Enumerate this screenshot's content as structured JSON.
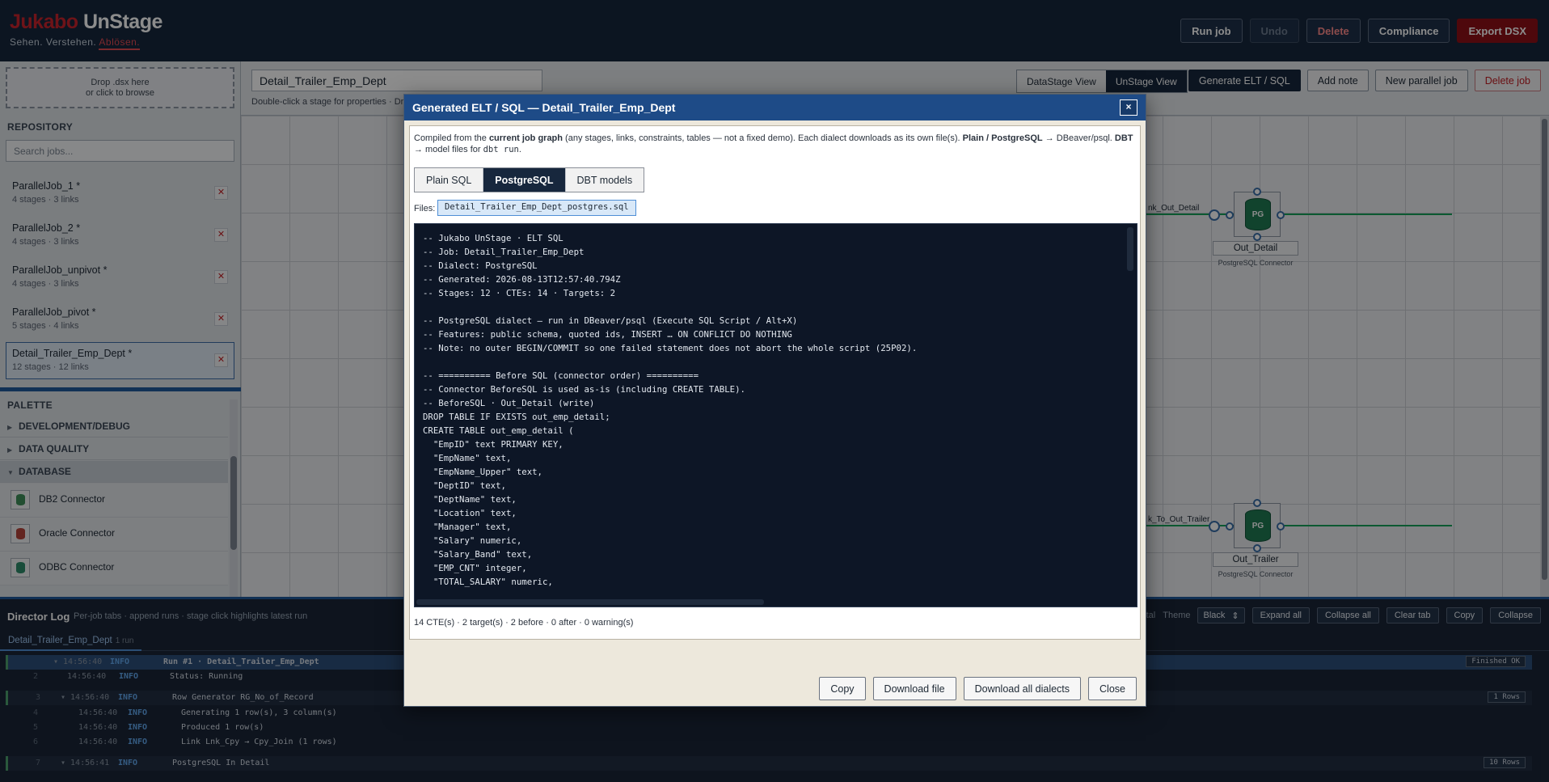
{
  "brand": {
    "name_part1": "Jukabo",
    "name_part2": " UnStage",
    "tagline": "Sehen. Verstehen.",
    "tagline_accent": "Ablösen."
  },
  "top_actions": {
    "run_job": "Run job",
    "undo": "Undo",
    "delete": "Delete",
    "compliance": "Compliance",
    "export": "Export DSX"
  },
  "sidebar": {
    "dropzone_line1": "Drop .dsx here",
    "dropzone_line2": "or click to browse",
    "repository_title": "REPOSITORY",
    "search_placeholder": "Search jobs...",
    "jobs": [
      {
        "name": "ParallelJob_1 *",
        "stats": "4 stages · 3 links"
      },
      {
        "name": "ParallelJob_2 *",
        "stats": "4 stages · 3 links"
      },
      {
        "name": "ParallelJob_unpivot *",
        "stats": "4 stages · 3 links"
      },
      {
        "name": "ParallelJob_pivot *",
        "stats": "5 stages · 4 links"
      },
      {
        "name": "Detail_Trailer_Emp_Dept *",
        "stats": "12 stages · 12 links"
      }
    ],
    "remove_glyph": "✕",
    "palette_title": "PALETTE",
    "palette_groups": [
      "DEVELOPMENT/DEBUG",
      "DATA QUALITY",
      "DATABASE"
    ],
    "palette_items": [
      "DB2 Connector",
      "Oracle Connector",
      "ODBC Connector"
    ]
  },
  "canvas_head": {
    "job_name": "Detail_Trailer_Emp_Dept",
    "hint": "Double-click a stage for properties · Dr",
    "view_datastage": "DataStage View",
    "view_unstage": "UnStage View",
    "generate": "Generate ELT / SQL",
    "add_note": "Add note",
    "new_parallel": "New parallel job",
    "delete_job": "Delete job"
  },
  "canvas": {
    "link1_label": "nk_Out_Detail",
    "link2_label": "k_To_Out_Trailer",
    "stage1": {
      "name": "Out_Detail",
      "type": "PostgreSQL Connector",
      "badge": "PG"
    },
    "stage2": {
      "name": "Out_Trailer",
      "type": "PostgreSQL Connector",
      "badge": "PG"
    }
  },
  "director_log": {
    "title": "Director Log",
    "subtitle": "Per-job tabs · append runs · stage click highlights latest run",
    "fatal_label": "Fatal",
    "theme_label": "Theme",
    "theme_value": "Black",
    "expand_all": "Expand all",
    "collapse_all": "Collapse all",
    "clear_tab": "Clear tab",
    "copy": "Copy",
    "collapse": "Collapse",
    "tab": {
      "name": "Detail_Trailer_Emp_Dept",
      "runs": "1 run"
    },
    "rows": [
      {
        "ln": "",
        "time": "▾ 14:56:40",
        "level": "INFO",
        "msg": "Run #1  · Detail_Trailer_Emp_Dept",
        "badge": "Finished OK"
      },
      {
        "ln": "2",
        "time": "14:56:40",
        "level": "INFO",
        "msg": "Status: Running",
        "badge": ""
      },
      {
        "ln": "3",
        "time": "▾ 14:56:40",
        "level": "INFO",
        "msg": "Row Generator RG_No_of_Record",
        "badge": "1 Rows"
      },
      {
        "ln": "4",
        "time": "14:56:40",
        "level": "INFO",
        "msg": "Generating 1 row(s), 3 column(s)",
        "badge": ""
      },
      {
        "ln": "5",
        "time": "14:56:40",
        "level": "INFO",
        "msg": "Produced 1 row(s)",
        "badge": ""
      },
      {
        "ln": "6",
        "time": "14:56:40",
        "level": "INFO",
        "msg": "Link Lnk_Cpy → Cpy_Join (1 rows)",
        "badge": ""
      },
      {
        "ln": "7",
        "time": "▾ 14:56:41",
        "level": "INFO",
        "msg": "PostgreSQL In Detail",
        "badge": "10 Rows"
      }
    ]
  },
  "modal": {
    "title": "Generated ELT / SQL — Detail_Trailer_Emp_Dept",
    "close_glyph": "×",
    "intro_1": "Compiled from the ",
    "intro_2": "current job graph",
    "intro_3": " (any stages, links, constraints, tables — not a fixed demo). Each dialect downloads as its own file(s). ",
    "intro_4": "Plain / PostgreSQL",
    "intro_5": " → DBeaver/psql. ",
    "intro_6": "DBT",
    "intro_7": " → model files for ",
    "intro_8": "dbt run",
    "intro_9": ".",
    "tabs": [
      "Plain SQL",
      "PostgreSQL",
      "DBT models"
    ],
    "active_tab": "PostgreSQL",
    "files_label": "Files:",
    "file_name": "Detail_Trailer_Emp_Dept_postgres.sql",
    "code": "-- Jukabo UnStage · ELT SQL\n-- Job: Detail_Trailer_Emp_Dept\n-- Dialect: PostgreSQL\n-- Generated: 2026-08-13T12:57:40.794Z\n-- Stages: 12 · CTEs: 14 · Targets: 2\n\n-- PostgreSQL dialect — run in DBeaver/psql (Execute SQL Script / Alt+X)\n-- Features: public schema, quoted ids, INSERT … ON CONFLICT DO NOTHING\n-- Note: no outer BEGIN/COMMIT so one failed statement does not abort the whole script (25P02).\n\n-- ========== Before SQL (connector order) ==========\n-- Connector BeforeSQL is used as-is (including CREATE TABLE).\n-- BeforeSQL · Out_Detail (write)\nDROP TABLE IF EXISTS out_emp_detail;\nCREATE TABLE out_emp_detail (\n  \"EmpID\" text PRIMARY KEY,\n  \"EmpName\" text,\n  \"EmpName_Upper\" text,\n  \"DeptID\" text,\n  \"DeptName\" text,\n  \"Location\" text,\n  \"Manager\" text,\n  \"Salary\" numeric,\n  \"Salary_Band\" text,\n  \"EMP_CNT\" integer,\n  \"TOTAL_SALARY\" numeric,",
    "stats": "14 CTE(s) · 2 target(s) · 2 before · 0 after · 0 warning(s)",
    "btn_copy": "Copy",
    "btn_download": "Download file",
    "btn_download_all": "Download all dialects",
    "btn_close": "Close"
  }
}
